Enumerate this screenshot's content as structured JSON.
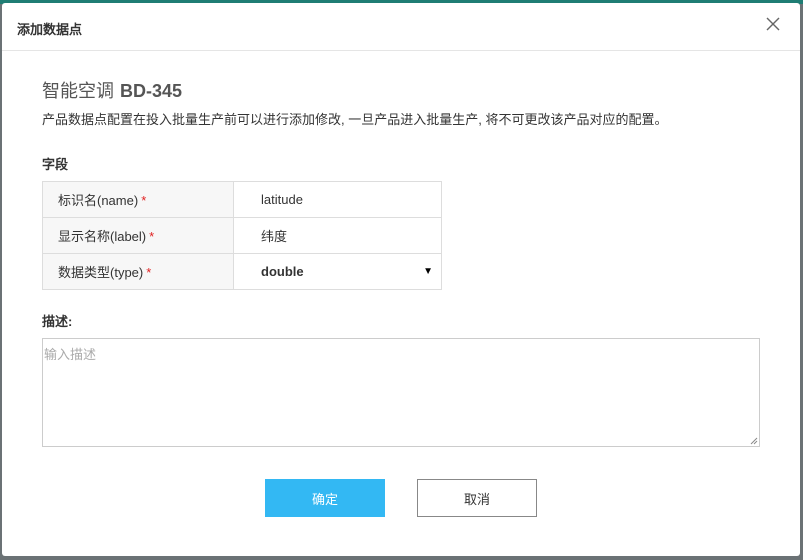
{
  "dialog": {
    "title": "添加数据点",
    "close_label": "×"
  },
  "product": {
    "name": "智能空调",
    "model": "BD-345"
  },
  "notice": "产品数据点配置在投入批量生产前可以进行添加修改, 一旦产品进入批量生产, 将不可更改该产品对应的配置。",
  "fields_section": {
    "label": "字段",
    "rows": [
      {
        "label": "标识名(name)",
        "required": "*",
        "value": "latitude"
      },
      {
        "label": "显示名称(label)",
        "required": "*",
        "value": "纬度"
      },
      {
        "label": "数据类型(type)",
        "required": "*",
        "value": "double",
        "arrow": "▼"
      }
    ]
  },
  "description": {
    "label": "描述:",
    "placeholder": "输入描述",
    "value": ""
  },
  "buttons": {
    "confirm": "确定",
    "cancel": "取消"
  },
  "colors": {
    "primary": "#33b8f3",
    "required": "#e02020"
  }
}
